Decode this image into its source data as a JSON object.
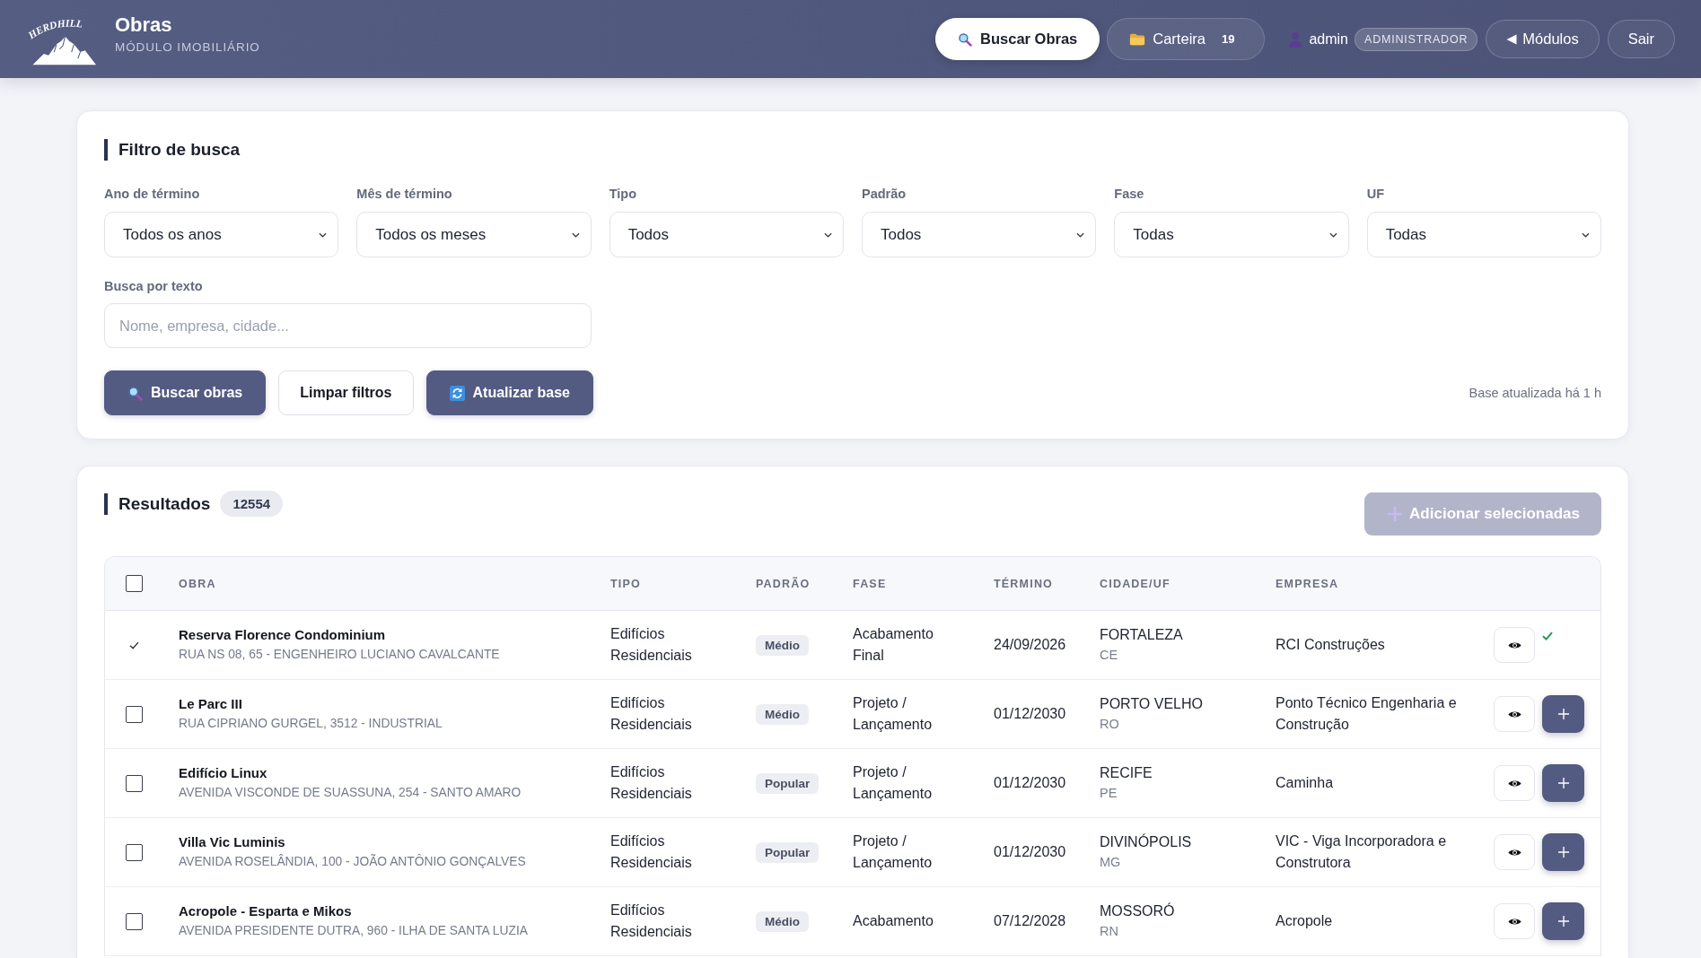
{
  "header": {
    "logo_text": "HERDHILL",
    "title": "Obras",
    "subtitle": "MÓDULO IMOBILIÁRIO",
    "nav": [
      {
        "kind": "search",
        "label": "Buscar Obras",
        "selected": true
      },
      {
        "kind": "portfolio",
        "label": "Carteira",
        "count": "19",
        "selected": false
      }
    ],
    "user": {
      "name": "admin",
      "role": "ADMINISTRADOR"
    },
    "actions": [
      {
        "kind": "back",
        "label": "Módulos"
      },
      {
        "kind": "logout",
        "label": "Sair"
      }
    ]
  },
  "filter": {
    "title": "Filtro de busca",
    "selects": [
      {
        "label": "Ano de término",
        "value": "Todos os anos"
      },
      {
        "label": "Mês de término",
        "value": "Todos os meses"
      },
      {
        "label": "Tipo",
        "value": "Todos"
      },
      {
        "label": "Padrão",
        "value": "Todos"
      },
      {
        "label": "Fase",
        "value": "Todas"
      },
      {
        "label": "UF",
        "value": "Todas"
      }
    ],
    "text_search": {
      "label": "Busca por texto",
      "placeholder": "Nome, empresa, cidade..."
    },
    "buttons": [
      {
        "kind": "search",
        "label": "Buscar obras"
      },
      {
        "kind": "clear",
        "label": "Limpar filtros"
      },
      {
        "kind": "refresh",
        "label": "Atualizar base"
      }
    ],
    "status": "Base atualizada há 1 h"
  },
  "results": {
    "title": "Resultados",
    "count": "12554",
    "add_button": {
      "label": "Adicionar selecionadas",
      "disabled": true
    },
    "table": {
      "select_all": {
        "checked": false
      },
      "columns": [
        "OBRA",
        "TIPO",
        "PADRÃO",
        "FASE",
        "TÉRMINO",
        "CIDADE/UF",
        "EMPRESA"
      ],
      "rows": [
        {
          "name": "Reserva Florence Condominium",
          "address": "RUA NS 08, 65 - ENGENHEIRO LUCIANO CAVALCANTE",
          "type": "Edifícios Residenciais",
          "standard": "Médio",
          "phase": "Acabamento Final",
          "end_date": "24/09/2026",
          "city": "FORTALEZA",
          "state": "CE",
          "company": "RCI Construções",
          "added": true
        },
        {
          "name": "Le Parc III",
          "address": "RUA CIPRIANO GURGEL, 3512 - INDUSTRIAL",
          "type": "Edifícios Residenciais",
          "standard": "Médio",
          "phase": "Projeto / Lançamento",
          "end_date": "01/12/2030",
          "city": "PORTO VELHO",
          "state": "RO",
          "company": "Ponto Técnico Engenharia e Construção",
          "added": false,
          "checked": false
        },
        {
          "name": "Edifício Linux",
          "address": "AVENIDA VISCONDE DE SUASSUNA, 254 - SANTO AMARO",
          "type": "Edifícios Residenciais",
          "standard": "Popular",
          "phase": "Projeto / Lançamento",
          "end_date": "01/12/2030",
          "city": "RECIFE",
          "state": "PE",
          "company": "Caminha",
          "added": false,
          "checked": false
        },
        {
          "name": "Villa Vic Luminis",
          "address": "AVENIDA ROSELÂNDIA, 100 - JOÃO ANTÔNIO GONÇALVES",
          "type": "Edifícios Residenciais",
          "standard": "Popular",
          "phase": "Projeto / Lançamento",
          "end_date": "01/12/2030",
          "city": "DIVINÓPOLIS",
          "state": "MG",
          "company": "VIC - Viga Incorporadora e Construtora",
          "added": false,
          "checked": false
        },
        {
          "name": "Acropole - Esparta e Mikos",
          "address": "AVENIDA PRESIDENTE DUTRA, 960 - ILHA DE SANTA LUZIA",
          "type": "Edifícios Residenciais",
          "standard": "Médio",
          "phase": "Acabamento",
          "end_date": "07/12/2028",
          "city": "MOSSORÓ",
          "state": "RN",
          "company": "Acropole",
          "added": false,
          "checked": false
        }
      ]
    }
  }
}
